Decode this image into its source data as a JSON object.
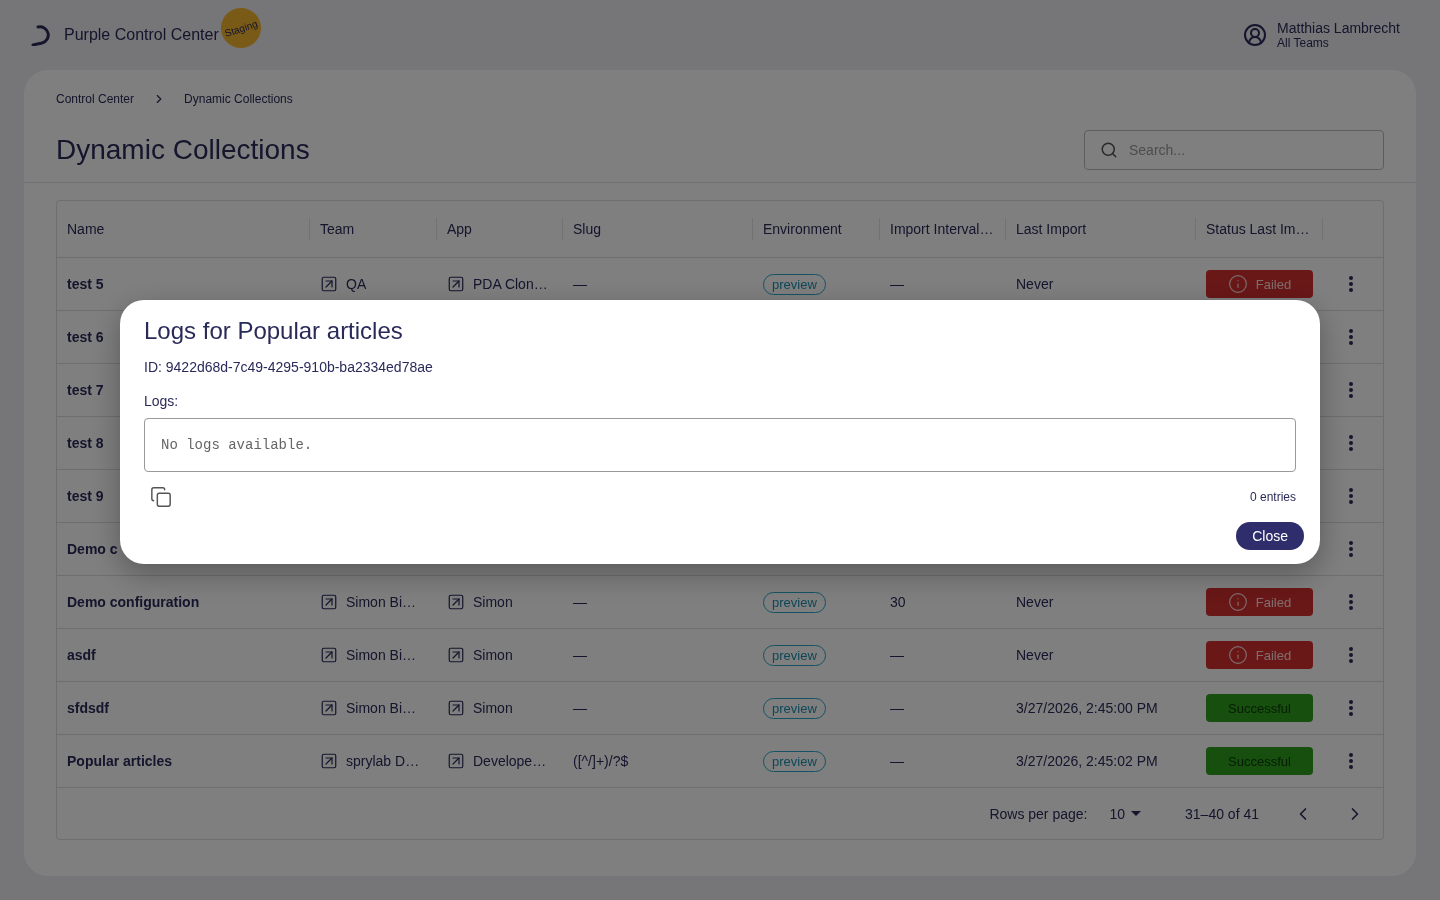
{
  "header": {
    "brand_bold": "Purple",
    "brand_rest": "Control Center",
    "badge": "Staging",
    "user": {
      "name": "Matthias Lambrecht",
      "team": "All Teams"
    }
  },
  "breadcrumbs": [
    {
      "label": "Control Center"
    },
    {
      "label": "Dynamic Collections"
    }
  ],
  "page_title": "Dynamic Collections",
  "search": {
    "placeholder": "Search..."
  },
  "table": {
    "columns": [
      "Name",
      "Team",
      "App",
      "Slug",
      "Environment",
      "Import Interval…",
      "Last Import",
      "Status Last Im…"
    ],
    "rows": [
      {
        "name": "test 5",
        "team": "QA",
        "app": "PDA Clon…",
        "slug": "—",
        "environment": "preview",
        "interval": "—",
        "last_import": "Never",
        "status": {
          "label": "Failed",
          "kind": "failed"
        }
      },
      {
        "name": "test 6"
      },
      {
        "name": "test 7"
      },
      {
        "name": "test 8"
      },
      {
        "name": "test 9"
      },
      {
        "name": "Demo c"
      },
      {
        "name": "Demo configuration",
        "team": "Simon Bi…",
        "app": "Simon",
        "slug": "—",
        "environment": "preview",
        "interval": "30",
        "last_import": "Never",
        "status": {
          "label": "Failed",
          "kind": "failed"
        }
      },
      {
        "name": "asdf",
        "team": "Simon Bi…",
        "app": "Simon",
        "slug": "—",
        "environment": "preview",
        "interval": "—",
        "last_import": "Never",
        "status": {
          "label": "Failed",
          "kind": "failed"
        }
      },
      {
        "name": "sfdsdf",
        "team": "Simon Bi…",
        "app": "Simon",
        "slug": "—",
        "environment": "preview",
        "interval": "—",
        "last_import": "3/27/2026, 2:45:00 PM",
        "status": {
          "label": "Successful",
          "kind": "successful"
        }
      },
      {
        "name": "Popular articles",
        "team": "sprylab D…",
        "app": "Develope…",
        "slug": "([^/]+)/?$",
        "environment": "preview",
        "interval": "—",
        "last_import": "3/27/2026, 2:45:02 PM",
        "status": {
          "label": "Successful",
          "kind": "successful"
        }
      }
    ],
    "footer": {
      "rows_label": "Rows per page:",
      "rows_value": "10",
      "range": "31–40 of 41"
    }
  },
  "dialog": {
    "title": "Logs for Popular articles",
    "id_line": "ID: 9422d68d-7c49-4295-910b-ba2334ed78ae",
    "logs_label": "Logs:",
    "logs_text": "No logs available.",
    "entries": "0 entries",
    "close": "Close"
  }
}
